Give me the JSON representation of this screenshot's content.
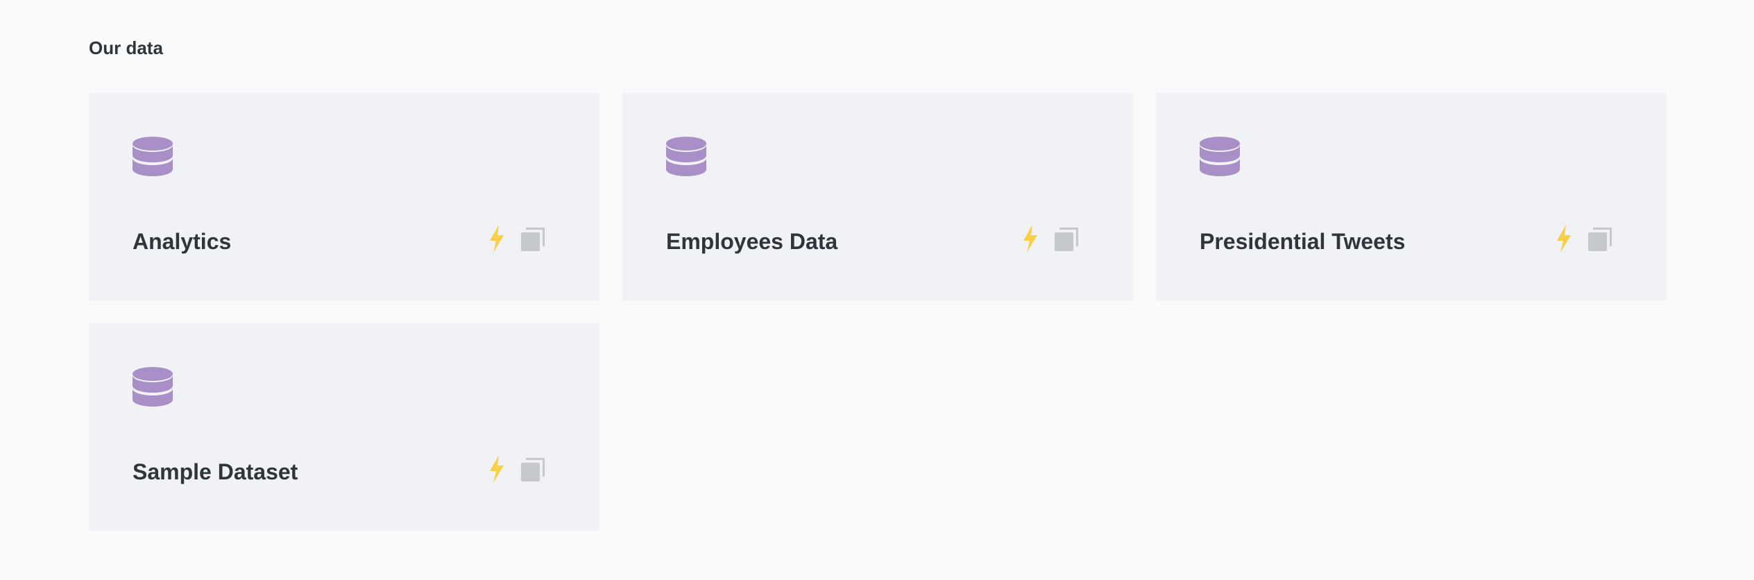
{
  "section": {
    "title": "Our data"
  },
  "databases": [
    {
      "name": "Analytics"
    },
    {
      "name": "Employees Data"
    },
    {
      "name": "Presidential Tweets"
    },
    {
      "name": "Sample Dataset"
    }
  ],
  "icons": {
    "database": "database-icon",
    "bolt": "lightning-bolt-icon",
    "copy": "copy-icon"
  },
  "colors": {
    "background": "#f9fafc",
    "card": "#f0f2f5",
    "database_icon": "#a98fc7",
    "bolt_icon": "#f9cf48",
    "copy_icon": "#c5c9cd",
    "title_text": "#2e353b"
  }
}
